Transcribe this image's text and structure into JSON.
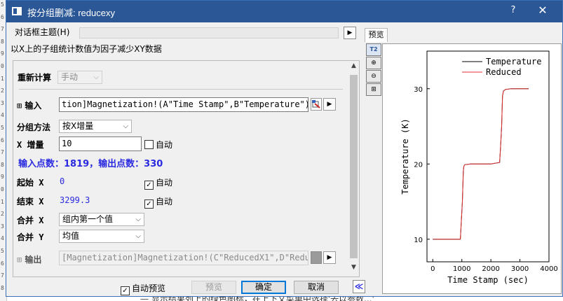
{
  "background": {
    "line_numbers": [
      "5",
      "6",
      "7",
      "8",
      "9",
      "0",
      "1",
      "2",
      "3",
      "4",
      "5",
      "6",
      "7",
      "8",
      "9",
      "0",
      "1",
      "2",
      "3",
      "4",
      "5",
      "6",
      "7",
      "8"
    ],
    "doc_text": "— 显示结果列上的绿色图标，在上下文菜单中选择'去以参数...'"
  },
  "window": {
    "title": "按分组删减: reducexy",
    "help_label": "?",
    "close_label": "✕"
  },
  "theme": {
    "label": "对话框主题(H)",
    "play_label": "▶"
  },
  "description": "以X上的子组统计数值为因子减少XY数据",
  "preview_tab": "预览",
  "form": {
    "recalc_label": "重新计算",
    "recalc_value": "手动",
    "input_label": "输入",
    "input_value": "tion]Magnetization!(A\"Time Stamp\",B\"Temperature\")",
    "group_label": "分组方法",
    "group_value": "按X增量",
    "increment_label": "X 增量",
    "increment_value": "10",
    "increment_auto": "自动",
    "points_info": "输入点数：1819，输出点数：330",
    "start_label": "起始 X",
    "start_value": "0",
    "start_auto": "自动",
    "end_label": "结束 X",
    "end_value": "3299.3",
    "end_auto": "自动",
    "merge_x_label": "合并 X",
    "merge_x_value": "组内第一个值",
    "merge_y_label": "合并 Y",
    "merge_y_value": "均值",
    "output_label": "输出",
    "output_value": "[Magnetization]Magnetization!(C\"ReducedX1\",D\"Redu"
  },
  "buttons": {
    "auto_preview": "自动预览",
    "preview": "预览",
    "ok": "确定",
    "cancel": "取消",
    "collapse": "≪"
  },
  "tools": [
    "T2",
    "⊕",
    "⊖",
    "⊞"
  ],
  "colors": {
    "title_bar": "#2b5797",
    "series_temperature": "#000000",
    "series_reduced": "#e03030",
    "info_blue": "#2a2ae0"
  },
  "chart_data": {
    "type": "line",
    "xlabel": "Time Stamp (sec)",
    "ylabel": "Temperature (K)",
    "xlim": [
      -200,
      4000
    ],
    "ylim": [
      7,
      35
    ],
    "xticks": [
      0,
      1000,
      2000,
      3000,
      4000
    ],
    "yticks": [
      10,
      20,
      30
    ],
    "legend": "top-right",
    "series": [
      {
        "name": "Temperature",
        "color": "#000000",
        "x": [
          0,
          950,
          1020,
          1050,
          1070,
          1100,
          1300,
          1600,
          2000,
          2300,
          2330,
          2370,
          2400,
          2430,
          2500,
          2700,
          3000,
          3300
        ],
        "y": [
          10,
          10,
          15,
          19,
          19.7,
          19.9,
          20,
          20,
          20,
          20.2,
          22,
          25,
          29,
          29.7,
          29.9,
          30,
          30,
          30
        ]
      },
      {
        "name": "Reduced",
        "color": "#e03030",
        "x": [
          0,
          950,
          1020,
          1050,
          1070,
          1100,
          1300,
          1600,
          2000,
          2300,
          2330,
          2370,
          2400,
          2430,
          2500,
          2700,
          3000,
          3300
        ],
        "y": [
          10,
          10,
          15,
          19,
          19.7,
          19.9,
          20,
          20,
          20,
          20.2,
          22,
          25,
          29,
          29.7,
          29.9,
          30,
          30,
          30
        ]
      }
    ]
  }
}
